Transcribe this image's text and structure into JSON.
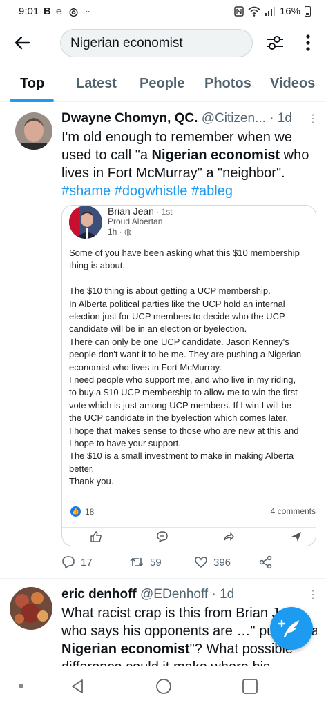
{
  "status_bar": {
    "time": "9:01",
    "app_icons": [
      "B",
      "℮",
      "◎",
      "··"
    ],
    "battery": "16%"
  },
  "search": {
    "query": "Nigerian economist"
  },
  "tabs": [
    "Top",
    "Latest",
    "People",
    "Photos",
    "Videos"
  ],
  "tweet1": {
    "name": "Dwayne Chomyn, QC.",
    "handle": "@Citizen...",
    "age": "· 1d",
    "text_before": "I'm old enough to remember when we used to call \"a ",
    "text_bold": "Nigerian economist",
    "text_after": " who lives in Fort McMurray\" a \"neighbor\".",
    "hashtags": "#shame #dogwhistle #ableg",
    "embed": {
      "name": "Brian Jean",
      "degree": " · 1st",
      "subtitle": "Proud Albertan",
      "time": "1h · ",
      "paragraphs": [
        "Some of you have been asking what this $10 membership",
        "thing is about.",
        "",
        "The $10 thing is about getting  a UCP membership.",
        "In Alberta political parties like the UCP hold an internal",
        "election just for UCP members to decide who the UCP",
        "candidate will be in an election or byelection.",
        "There can only be one UCP candidate. Jason Kenney's",
        "people don't want it to be me. They are pushing a Nigerian",
        "economist who lives in Fort McMurray.",
        "I need people who support me, and who live in my riding,",
        "to buy a $10 UCP  membership to allow me to win the first",
        "vote which is just among UCP members. If I win I will be",
        "the UCP candidate in the byelection which comes later.",
        "I hope that makes sense to those who are new at this and",
        "I hope to have your support.",
        "The $10 is a small investment to make in making Alberta",
        "better.",
        "Thank you."
      ],
      "reactions": "18",
      "comments": "4 comments"
    },
    "replies": "17",
    "retweets": "59",
    "likes": "396"
  },
  "tweet2": {
    "name": "eric denhoff",
    "handle": "@EDenhoff",
    "age": "· 1d",
    "line1": "What racist crap is this from Brian Jean,",
    "line2": "who says his opponents are …\" pushing a",
    "line3_bold": "Nigerian economist",
    "line3_rest": "\"? What possible",
    "line4": "difference could it make where his"
  },
  "colors": {
    "accent": "#1d9bf0",
    "text": "#0f1419",
    "muted": "#536471",
    "facebook_blue": "#1877f2"
  }
}
